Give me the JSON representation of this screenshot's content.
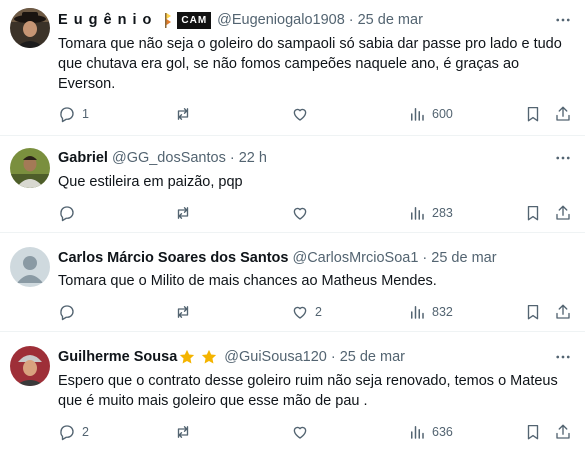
{
  "tweets": [
    {
      "display_name": "E u g ê n i o",
      "badge_text": "CAM",
      "handle": "@Eugeniogalo1908",
      "time": "25 de mar",
      "text": "Tomara que não seja o goleiro do sampaoli só sabia dar passe pro lado e tudo que chutava era gol, se não fomos campeões naquele ano, é graças ao Everson.",
      "replies": "1",
      "retweets": "",
      "likes": "",
      "views": "600",
      "colors": {
        "avatar_bg": "#3b3228",
        "skin": "#c69574",
        "shirt": "#1c1c1c"
      }
    },
    {
      "display_name": "Gabriel",
      "handle": "@GG_dosSantos",
      "time": "22 h",
      "text": "Que estileira em paizão, pqp",
      "replies": "",
      "retweets": "",
      "likes": "",
      "views": "283",
      "colors": {
        "avatar_bg": "#7a8f3e",
        "skin": "#a47a57",
        "shirt": "#d8d8d0"
      }
    },
    {
      "display_name": "Carlos Márcio Soares dos Santos",
      "handle": "@CarlosMrcioSoa1",
      "time": "25 de mar",
      "text": "Tomara que o Milito de mais chances ao Matheus Mendes.",
      "replies": "",
      "retweets": "",
      "likes": "2",
      "views": "832",
      "colors": {
        "avatar_bg": "#cfd9de",
        "silhouette": "#8a9aa4"
      }
    },
    {
      "display_name": "Guilherme Sousa",
      "handle": "@GuiSousa120",
      "time": "25 de mar",
      "text": "Espero que o contrato desse goleiro ruim não seja renovado, temos o Mateus que é muito mais goleiro que esse mão de pau .",
      "replies": "2",
      "retweets": "",
      "likes": "",
      "views": "636",
      "colors": {
        "avatar_bg": "#9e2f38",
        "skin": "#d9a27e",
        "shirt": "#3a3a3a"
      }
    }
  ],
  "icons": {
    "more": "more-dots-icon",
    "reply": "reply-icon",
    "retweet": "retweet-icon",
    "like": "heart-icon",
    "views": "views-chart-icon",
    "bookmark": "bookmark-icon",
    "share": "share-icon",
    "star": "star-icon",
    "flag": "pennant-icon"
  },
  "colors": {
    "text": "#0f1419",
    "muted": "#536471",
    "divider": "#eff3f4",
    "star": "#f4b400"
  }
}
